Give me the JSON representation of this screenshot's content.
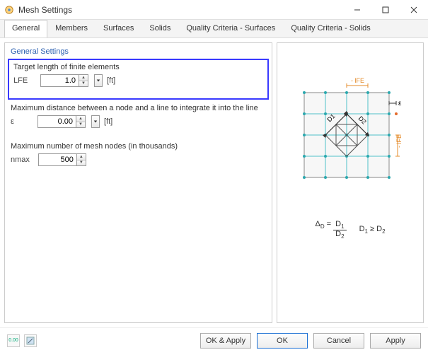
{
  "window": {
    "title": "Mesh Settings"
  },
  "tabs": [
    "General",
    "Members",
    "Surfaces",
    "Solids",
    "Quality Criteria - Surfaces",
    "Quality Criteria - Solids"
  ],
  "active_tab_index": 0,
  "general": {
    "group_title": "General Settings",
    "target_len": {
      "label": "Target length of finite elements",
      "symbol": "LFE",
      "value": "1.0",
      "unit": "[ft]"
    },
    "max_dist": {
      "label": "Maximum distance between a node and a line to integrate it into the line",
      "symbol": "ε",
      "value": "0.00",
      "unit": "[ft]"
    },
    "max_nodes": {
      "label": "Maximum number of mesh nodes (in thousands)",
      "symbol": "nmax",
      "value": "500"
    }
  },
  "diagram": {
    "lfe_h": "- lFE",
    "lfe_v": "- lFE",
    "eps": "ε",
    "d1": "D1",
    "d2": "D2"
  },
  "formula": {
    "delta_sym": "ΔD",
    "eq": " = ",
    "num": "D1",
    "den": "D2",
    "cond_left": "D1",
    "cond_op": " ≥ ",
    "cond_right": "D2"
  },
  "footer": {
    "icon1_text": "0.00",
    "ok_apply": "OK & Apply",
    "ok": "OK",
    "cancel": "Cancel",
    "apply": "Apply"
  }
}
